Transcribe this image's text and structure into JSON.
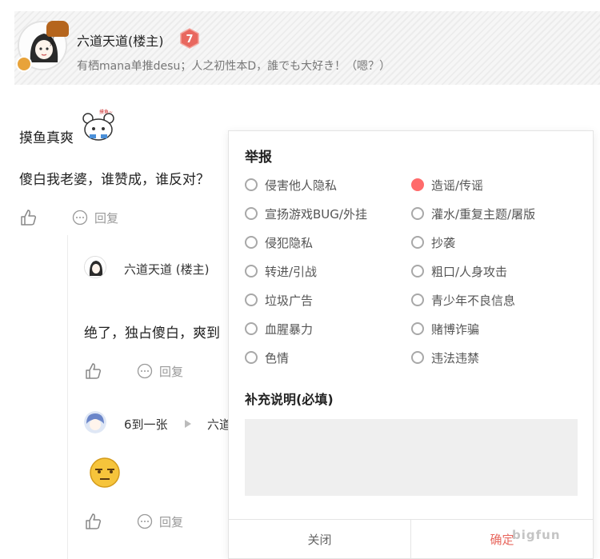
{
  "poster": {
    "name": "六道天道(楼主)",
    "level": "7",
    "signature": "有栖mana单推desu；人之初性本D，誰でも大好き！（嗯？）"
  },
  "post": {
    "line1": "摸鱼真爽",
    "line2": "傻白我老婆，谁赞成，谁反对？",
    "reply_label": "回复"
  },
  "comments": [
    {
      "name": "六道天道 (楼主)",
      "text": "绝了，独占傻白，爽到",
      "reply_label": "回复"
    },
    {
      "name": "6到一张",
      "reply_to": "六道",
      "reply_label": "回复"
    }
  ],
  "report_modal": {
    "title": "举报",
    "reasons_left": [
      "侵害他人隐私",
      "宣扬游戏BUG/外挂",
      "侵犯隐私",
      "转进/引战",
      "垃圾广告",
      "血腥暴力",
      "色情"
    ],
    "reasons_right": [
      "造谣/传谣",
      "灌水/重复主题/屠版",
      "抄袭",
      "粗口/人身攻击",
      "青少年不良信息",
      "赌博诈骗",
      "违法违禁"
    ],
    "selected": "造谣/传谣",
    "supplement_title": "补充说明(必填)",
    "supplement_value": "",
    "close_label": "关闭",
    "confirm_label": "确定"
  },
  "watermark": "bigfun",
  "colors": {
    "accent": "#ff6b6b",
    "level_badge": "#e8685f",
    "confirm_text": "#e8685f"
  }
}
